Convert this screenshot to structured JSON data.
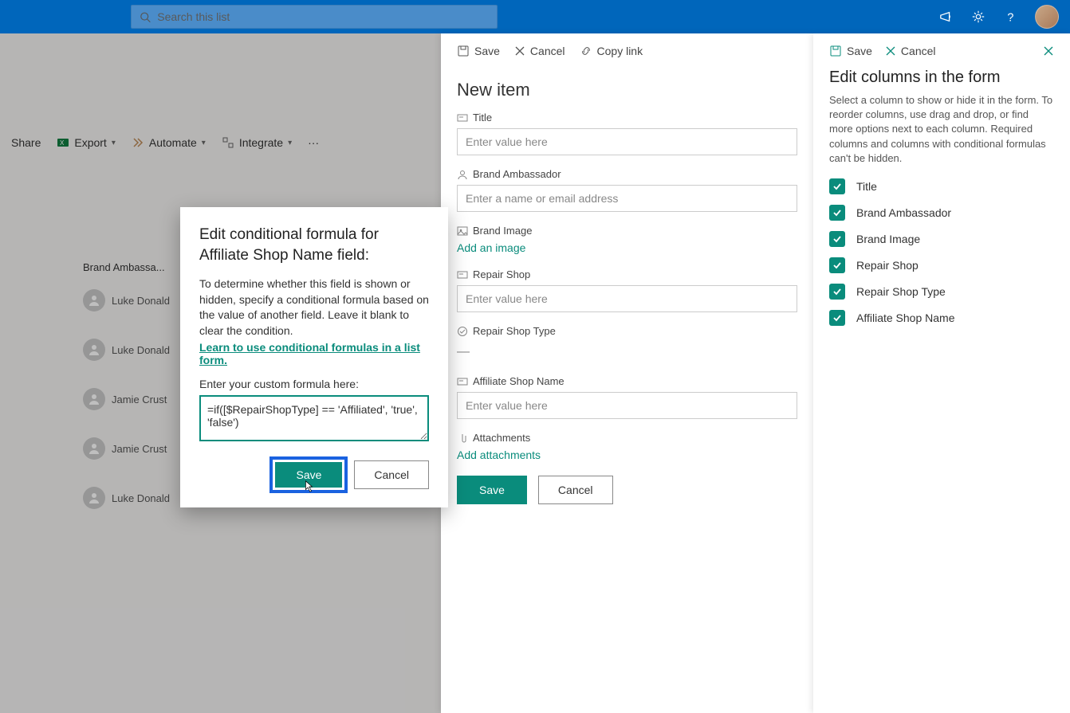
{
  "topbar": {
    "search_placeholder": "Search this list"
  },
  "cmdbar": {
    "share": "Share",
    "export": "Export",
    "automate": "Automate",
    "integrate": "Integrate"
  },
  "list": {
    "col_header": "Brand Ambassa...",
    "rows": [
      {
        "name": "Luke Donald"
      },
      {
        "name": "Luke Donald"
      },
      {
        "name": "Jamie Crust"
      },
      {
        "name": "Jamie Crust"
      },
      {
        "name": "Luke Donald"
      }
    ]
  },
  "form": {
    "cmd_save": "Save",
    "cmd_cancel": "Cancel",
    "cmd_copy": "Copy link",
    "title": "New item",
    "fields": {
      "title": {
        "label": "Title",
        "placeholder": "Enter value here"
      },
      "ambassador": {
        "label": "Brand Ambassador",
        "placeholder": "Enter a name or email address"
      },
      "image": {
        "label": "Brand Image",
        "add": "Add an image"
      },
      "shop": {
        "label": "Repair Shop",
        "placeholder": "Enter value here"
      },
      "shoptype": {
        "label": "Repair Shop Type",
        "dash": "—"
      },
      "affiliate": {
        "label": "Affiliate Shop Name",
        "placeholder": "Enter value here"
      },
      "attachments": {
        "label": "Attachments",
        "add": "Add attachments"
      }
    },
    "save_btn": "Save",
    "cancel_btn": "Cancel"
  },
  "colpanel": {
    "cmd_save": "Save",
    "cmd_cancel": "Cancel",
    "title": "Edit columns in the form",
    "desc": "Select a column to show or hide it in the form. To reorder columns, use drag and drop, or find more options next to each column. Required columns and columns with conditional formulas can't be hidden.",
    "items": [
      "Title",
      "Brand Ambassador",
      "Brand Image",
      "Repair Shop",
      "Repair Shop Type",
      "Affiliate Shop Name"
    ]
  },
  "modal": {
    "heading": "Edit conditional formula for Affiliate Shop Name field:",
    "desc": "To determine whether this field is shown or hidden, specify a conditional formula based on the value of another field. Leave it blank to clear the condition.",
    "learn": "Learn to use conditional formulas in a list form.",
    "formula_label": "Enter your custom formula here:",
    "formula_value": "=if([$RepairShopType] == 'Affiliated', 'true', 'false')",
    "save": "Save",
    "cancel": "Cancel"
  }
}
